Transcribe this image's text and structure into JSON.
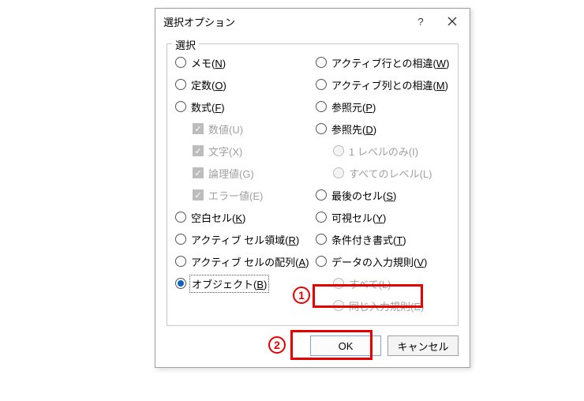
{
  "dialog": {
    "title": "選択オプション",
    "group_label": "選択",
    "left": [
      {
        "type": "radio",
        "text": "メモ(",
        "u": "N",
        "after": ")"
      },
      {
        "type": "radio",
        "text": "定数(",
        "u": "O",
        "after": ")"
      },
      {
        "type": "radio",
        "text": "数式(",
        "u": "F",
        "after": ")"
      },
      {
        "type": "check",
        "indent": true,
        "disabled": true,
        "text": "数値(U)"
      },
      {
        "type": "check",
        "indent": true,
        "disabled": true,
        "text": "文字(X)"
      },
      {
        "type": "check",
        "indent": true,
        "disabled": true,
        "text": "論理値(G)"
      },
      {
        "type": "check",
        "indent": true,
        "disabled": true,
        "text": "エラー値(E)"
      },
      {
        "type": "radio",
        "text": "空白セル(",
        "u": "K",
        "after": ")"
      },
      {
        "type": "radio",
        "text": "アクティブ セル領域(",
        "u": "R",
        "after": ")"
      },
      {
        "type": "radio",
        "text": "アクティブ セルの配列(",
        "u": "A",
        "after": ")"
      },
      {
        "type": "radio",
        "selected": true,
        "focus": true,
        "text": "オブジェクト(",
        "u": "B",
        "after": ")"
      }
    ],
    "right": [
      {
        "type": "radio",
        "text": "アクティブ行との相違(",
        "u": "W",
        "after": ")"
      },
      {
        "type": "radio",
        "text": "アクティブ列との相違(",
        "u": "M",
        "after": ")"
      },
      {
        "type": "radio",
        "text": "参照元(",
        "u": "P",
        "after": ")"
      },
      {
        "type": "radio",
        "text": "参照先(",
        "u": "D",
        "after": ")"
      },
      {
        "type": "radio",
        "indent": true,
        "disabled": true,
        "text": "1 レベルのみ(I)"
      },
      {
        "type": "radio",
        "indent": true,
        "disabled": true,
        "text": "すべてのレベル(L)"
      },
      {
        "type": "radio",
        "text": "最後のセル(",
        "u": "S",
        "after": ")"
      },
      {
        "type": "radio",
        "text": "可視セル(",
        "u": "Y",
        "after": ")"
      },
      {
        "type": "radio",
        "text": "条件付き書式(",
        "u": "T",
        "after": ")"
      },
      {
        "type": "radio",
        "text": "データの入力規則(",
        "u": "V",
        "after": ")"
      },
      {
        "type": "radio",
        "indent": true,
        "disabled": true,
        "text": "すべて(L)"
      },
      {
        "type": "radio",
        "indent": true,
        "disabled": true,
        "text": "同じ入力規則(E)"
      }
    ],
    "ok": "OK",
    "cancel": "キャンセル"
  },
  "annotations": {
    "n1": "1",
    "n2": "2"
  }
}
